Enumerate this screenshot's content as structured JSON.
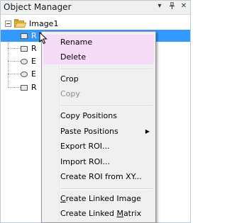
{
  "window": {
    "title": "Object Manager",
    "dropdown_icon": "dropdown-arrow-icon",
    "pin_icon": "pin-icon",
    "close_icon": "close-icon"
  },
  "tree": {
    "root_label": "Image1",
    "children": [
      {
        "shape": "rectangle",
        "label": "R",
        "selected": true
      },
      {
        "shape": "rectangle",
        "label": "R",
        "selected": false
      },
      {
        "shape": "ellipse",
        "label": "E",
        "selected": false
      },
      {
        "shape": "ellipse",
        "label": "E",
        "selected": false
      },
      {
        "shape": "rectangle",
        "label": "R",
        "selected": false
      }
    ]
  },
  "context_menu": {
    "rename": "Rename",
    "delete": "Delete",
    "crop": "Crop",
    "copy": "Copy",
    "copy_positions": "Copy Positions",
    "paste_positions": "Paste Positions",
    "export_roi": "Export ROI...",
    "import_roi": "Import ROI...",
    "create_roi_from_xy": "Create ROI from XY...",
    "create_linked_image_prefix": "",
    "create_linked_image_u": "C",
    "create_linked_image_rest": "reate Linked Image",
    "create_linked_matrix_prefix": "Create Linked ",
    "create_linked_matrix_u": "M",
    "create_linked_matrix_rest": "atrix"
  }
}
